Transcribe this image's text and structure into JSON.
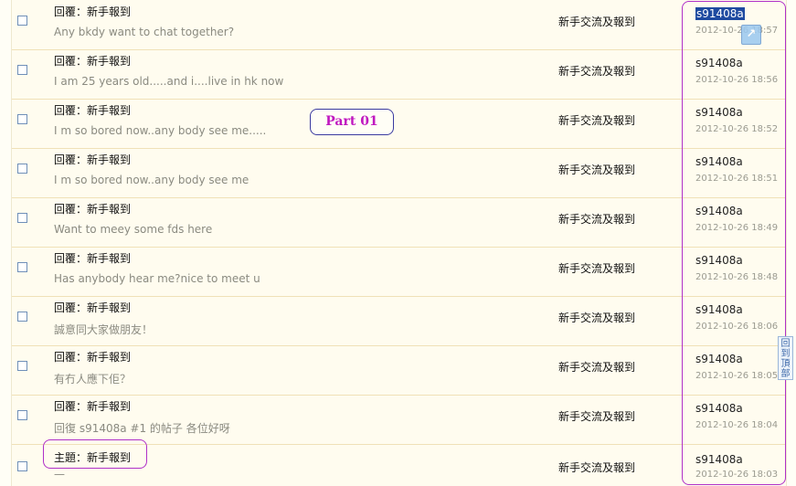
{
  "rows": [
    {
      "title": "回覆：新手報到",
      "snippet": "Any bkdy want to chat together?",
      "forum": "新手交流及報到",
      "author": "s91408a",
      "date": "2012-10-26 18:57"
    },
    {
      "title": "回覆：新手報到",
      "snippet": "I am 25 years old.....and i....live in hk now",
      "forum": "新手交流及報到",
      "author": "s91408a",
      "date": "2012-10-26 18:56"
    },
    {
      "title": "回覆：新手報到",
      "snippet": "I m so bored now..any body see me.....",
      "forum": "新手交流及報到",
      "author": "s91408a",
      "date": "2012-10-26 18:52"
    },
    {
      "title": "回覆：新手報到",
      "snippet": "I m so bored now..any body see me",
      "forum": "新手交流及報到",
      "author": "s91408a",
      "date": "2012-10-26 18:51"
    },
    {
      "title": "回覆：新手報到",
      "snippet": "Want to meey some fds here",
      "forum": "新手交流及報到",
      "author": "s91408a",
      "date": "2012-10-26 18:49"
    },
    {
      "title": "回覆：新手報到",
      "snippet": "Has anybody hear me?nice to meet u",
      "forum": "新手交流及報到",
      "author": "s91408a",
      "date": "2012-10-26 18:48"
    },
    {
      "title": "回覆：新手報到",
      "snippet": "誠意同大家做朋友！",
      "forum": "新手交流及報到",
      "author": "s91408a",
      "date": "2012-10-26 18:06"
    },
    {
      "title": "回覆：新手報到",
      "snippet": "有冇人應下佢？",
      "forum": "新手交流及報到",
      "author": "s91408a",
      "date": "2012-10-26 18:05"
    },
    {
      "title": "回覆：新手報到",
      "snippet": "回復 s91408a #1 的帖子 各位好呀",
      "forum": "新手交流及報到",
      "author": "s91408a",
      "date": "2012-10-26 18:04"
    },
    {
      "title": "主題：新手報到",
      "snippet": "—",
      "forum": "新手交流及報到",
      "author": "s91408a",
      "date": "2012-10-26 18:03"
    }
  ],
  "annotation": {
    "label": "Part 01"
  },
  "back_to_top": {
    "label": "回到頂部"
  },
  "icons": {
    "external": "external-link-icon",
    "checkbox": "checkbox-icon"
  },
  "colors": {
    "annotation": "#b030c8",
    "selection": "#1e4aa0",
    "row_border": "#f0e1b7"
  }
}
